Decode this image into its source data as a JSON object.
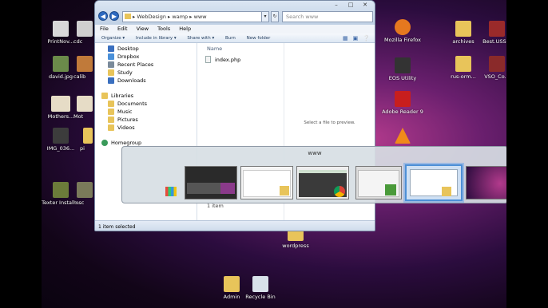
{
  "desktop": {
    "icons": [
      {
        "label": "PrintNov...",
        "color": "#d8d8d8"
      },
      {
        "label": "david.jpg",
        "color": "#6b8a4a"
      },
      {
        "label": "Mothers...",
        "color": "#e6dcc6"
      },
      {
        "label": "IMG_036...",
        "color": "#3c3c3c"
      },
      {
        "label": "Texter Install...",
        "color": "#6b7b3a"
      },
      {
        "label": "Mozilla Firefox",
        "color": "#e5781f"
      },
      {
        "label": "EOS Utility",
        "color": "#333333"
      },
      {
        "label": "Adobe Reader 9",
        "color": "#c81e1e"
      },
      {
        "label": "archives",
        "color": "#e8c45a"
      },
      {
        "label": "Best.USS...",
        "color": "#9a2a2a"
      },
      {
        "label": "rus-orm...",
        "color": "#e8c45a"
      },
      {
        "label": "VSO_Co...",
        "color": "#8a2a2a"
      },
      {
        "label": "wordpress",
        "color": "#e8c45a"
      },
      {
        "label": "Admin",
        "color": "#e8c45a"
      },
      {
        "label": "Recycle Bin",
        "color": "#d8e2ea"
      }
    ],
    "partial_labels": [
      "cdc",
      "calib",
      "Mot",
      "pi",
      "msc"
    ]
  },
  "explorer": {
    "address_parts": [
      "WebDesign",
      "wamp",
      "www"
    ],
    "search_placeholder": "Search www",
    "menu": [
      "File",
      "Edit",
      "View",
      "Tools",
      "Help"
    ],
    "toolbar": [
      "Organize ▾",
      "Include in library ▾",
      "Share with ▾",
      "Burn",
      "New folder"
    ],
    "nav_items": [
      {
        "label": "Desktop",
        "color": "#3a6fbf"
      },
      {
        "label": "Dropbox",
        "color": "#4a90d9"
      },
      {
        "label": "Recent Places",
        "color": "#7a8a9a"
      },
      {
        "label": "Study",
        "color": "#e8c45a"
      },
      {
        "label": "Downloads",
        "color": "#3a6fbf"
      },
      {
        "label": "Libraries",
        "color": "#e8c45a"
      },
      {
        "label": "Documents",
        "color": "#e8c45a"
      },
      {
        "label": "Music",
        "color": "#e8c45a"
      },
      {
        "label": "Pictures",
        "color": "#e8c45a"
      },
      {
        "label": "Videos",
        "color": "#e8c45a"
      },
      {
        "label": "Homegroup",
        "color": "#3a9a5a"
      }
    ],
    "column_header": "Name",
    "files": [
      "index.php"
    ],
    "preview_text": "Select a file to preview.",
    "item_count": "1 item",
    "status": "1 item selected"
  },
  "switcher": {
    "title": "www"
  }
}
